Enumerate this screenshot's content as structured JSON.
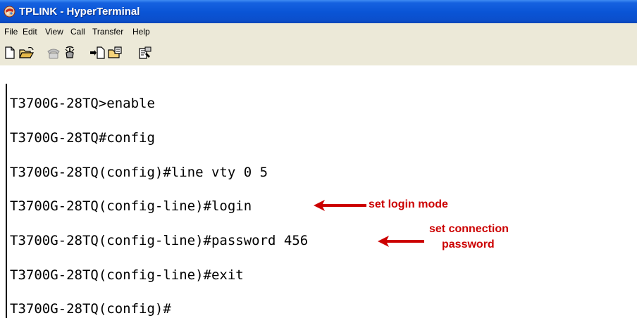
{
  "window": {
    "title": "TPLINK - HyperTerminal",
    "app_icon": "hyperterminal-icon"
  },
  "menu": {
    "items": [
      "File",
      "Edit",
      "View",
      "Call",
      "Transfer",
      "Help"
    ]
  },
  "toolbar": {
    "buttons": [
      "new-file-icon",
      "open-folder-icon",
      "phone-call-icon",
      "disconnect-icon",
      "send-file-icon",
      "receive-file-icon",
      "properties-icon"
    ]
  },
  "terminal": {
    "lines": [
      "T3700G-28TQ>enable",
      "T3700G-28TQ#config",
      "T3700G-28TQ(config)#line vty 0 5",
      "T3700G-28TQ(config-line)#login",
      "T3700G-28TQ(config-line)#password 456",
      "T3700G-28TQ(config-line)#exit",
      "T3700G-28TQ(config)#"
    ]
  },
  "annotations": {
    "login": "set login mode",
    "password_line1": "set connection",
    "password_line2": "password",
    "color": "#cc0000"
  }
}
